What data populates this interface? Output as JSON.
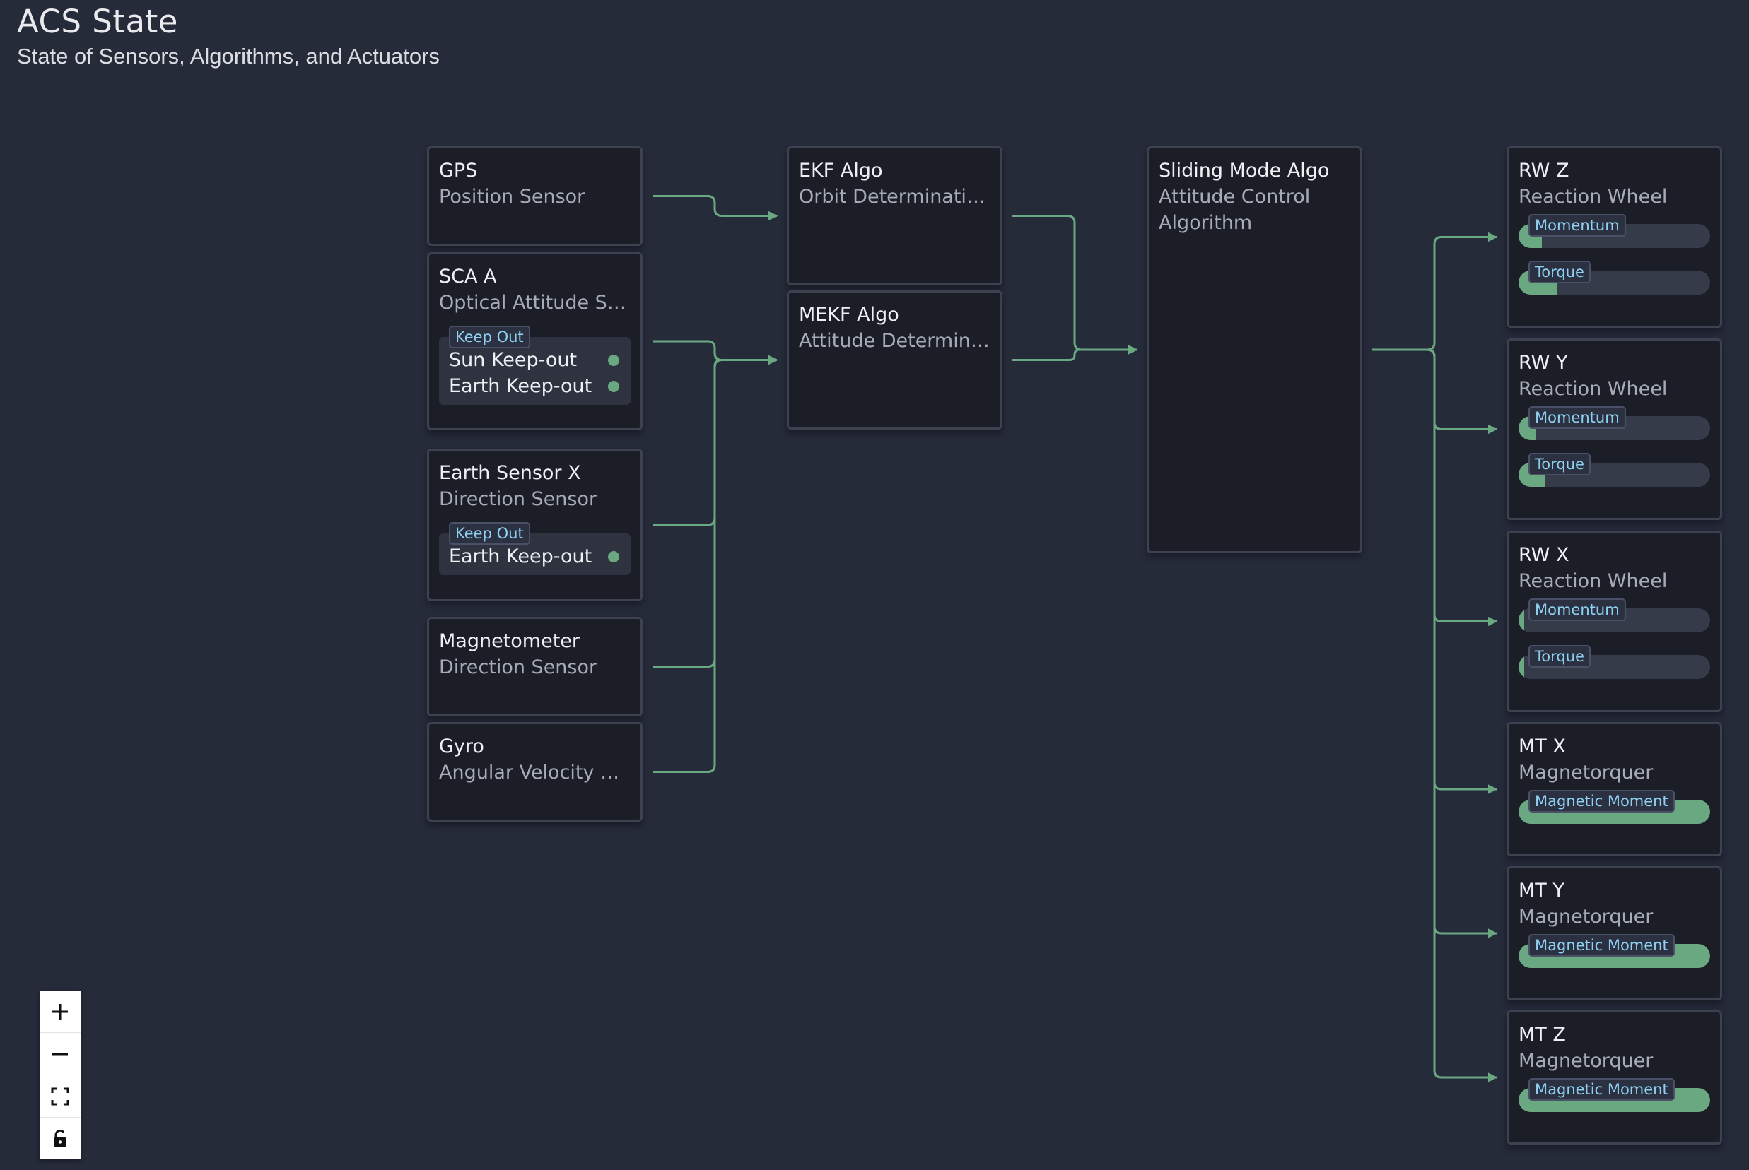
{
  "header": {
    "title": "ACS State",
    "subtitle": "State of Sensors, Algorithms, and Actuators"
  },
  "colors": {
    "background": "#262b3a",
    "node_background": "#1b1d27",
    "node_border": "#3d4150",
    "edge": "#6aa882",
    "chip_text": "#8fd0f2",
    "status_ok": "#6aa882"
  },
  "sensors": [
    {
      "id": "gps",
      "title": "GPS",
      "subtitle": "Position Sensor"
    },
    {
      "id": "sca_a",
      "title": "SCA A",
      "subtitle": "Optical Attitude Se...",
      "keepout": {
        "label": "Keep Out",
        "items": [
          "Sun Keep-out",
          "Earth Keep-out"
        ]
      }
    },
    {
      "id": "earth_sensor_x",
      "title": "Earth Sensor X",
      "subtitle": "Direction Sensor",
      "keepout": {
        "label": "Keep Out",
        "items": [
          "Earth Keep-out"
        ]
      }
    },
    {
      "id": "magnetometer",
      "title": "Magnetometer",
      "subtitle": "Direction Sensor"
    },
    {
      "id": "gyro",
      "title": "Gyro",
      "subtitle": "Angular Velocity Se..."
    }
  ],
  "estimators": [
    {
      "id": "ekf",
      "title": "EKF Algo",
      "subtitle": "Orbit Determinatio..."
    },
    {
      "id": "mekf",
      "title": "MEKF Algo",
      "subtitle": "Attitude Determina..."
    }
  ],
  "controller": {
    "id": "sliding_mode",
    "title": "Sliding Mode Algo",
    "subtitle": "Attitude Control Algorithm"
  },
  "actuators": [
    {
      "id": "rw_z",
      "title": "RW Z",
      "subtitle": "Reaction Wheel",
      "bars": [
        {
          "label": "Momentum",
          "fill": 0.12
        },
        {
          "label": "Torque",
          "fill": 0.2
        }
      ]
    },
    {
      "id": "rw_y",
      "title": "RW Y",
      "subtitle": "Reaction Wheel",
      "bars": [
        {
          "label": "Momentum",
          "fill": 0.09
        },
        {
          "label": "Torque",
          "fill": 0.14
        }
      ]
    },
    {
      "id": "rw_x",
      "title": "RW X",
      "subtitle": "Reaction Wheel",
      "bars": [
        {
          "label": "Momentum",
          "fill": 0.03
        },
        {
          "label": "Torque",
          "fill": 0.03
        }
      ]
    },
    {
      "id": "mt_x",
      "title": "MT X",
      "subtitle": "Magnetorquer",
      "bars": [
        {
          "label": "Magnetic Moment",
          "fill": 1.0
        }
      ]
    },
    {
      "id": "mt_y",
      "title": "MT Y",
      "subtitle": "Magnetorquer",
      "bars": [
        {
          "label": "Magnetic Moment",
          "fill": 1.0
        }
      ]
    },
    {
      "id": "mt_z",
      "title": "MT Z",
      "subtitle": "Magnetorquer",
      "bars": [
        {
          "label": "Magnetic Moment",
          "fill": 1.0
        }
      ]
    }
  ],
  "edges": [
    {
      "from": "gps",
      "to": "ekf"
    },
    {
      "from": "sca_a",
      "to": "mekf"
    },
    {
      "from": "earth_sensor_x",
      "to": "mekf"
    },
    {
      "from": "magnetometer",
      "to": "mekf"
    },
    {
      "from": "gyro",
      "to": "mekf"
    },
    {
      "from": "ekf",
      "to": "sliding_mode"
    },
    {
      "from": "mekf",
      "to": "sliding_mode"
    },
    {
      "from": "sliding_mode",
      "to": "rw_z"
    },
    {
      "from": "sliding_mode",
      "to": "rw_y"
    },
    {
      "from": "sliding_mode",
      "to": "rw_x"
    },
    {
      "from": "sliding_mode",
      "to": "mt_x"
    },
    {
      "from": "sliding_mode",
      "to": "mt_y"
    },
    {
      "from": "sliding_mode",
      "to": "mt_z"
    }
  ],
  "controls": [
    {
      "name": "zoom-in",
      "icon": "plus-icon"
    },
    {
      "name": "zoom-out",
      "icon": "minus-icon"
    },
    {
      "name": "fit-view",
      "icon": "fit-view-icon"
    },
    {
      "name": "lock",
      "icon": "lock-icon"
    }
  ]
}
